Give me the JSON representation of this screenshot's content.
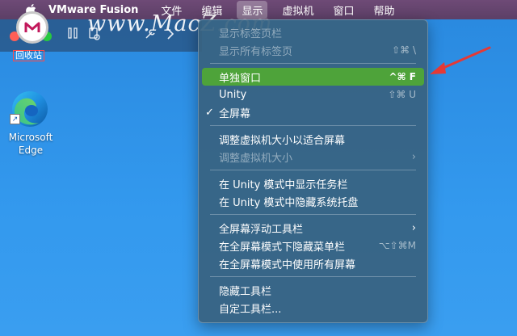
{
  "menubar": {
    "app_name": "VMware Fusion",
    "items": [
      "文件",
      "编辑",
      "显示",
      "虚拟机",
      "窗口",
      "帮助"
    ],
    "active_index": 2
  },
  "watermark": {
    "text": "www.MacZ.com"
  },
  "desktop": {
    "trash_label": "回收站",
    "edge_label_1": "Microsoft",
    "edge_label_2": "Edge"
  },
  "menu": {
    "g1": [
      {
        "label": "显示标签页栏",
        "shortcut": "",
        "disabled": true
      },
      {
        "label": "显示所有标签页",
        "shortcut": "⇧⌘ \\",
        "disabled": true
      }
    ],
    "g2": [
      {
        "label": "单独窗口",
        "shortcut": "^⌘ F",
        "highlight": true
      },
      {
        "label": "Unity",
        "shortcut": "⇧⌘ U"
      },
      {
        "label": "全屏幕",
        "shortcut": "",
        "checked": true,
        "check": "✓"
      }
    ],
    "g3": [
      {
        "label": "调整虚拟机大小以适合屏幕",
        "shortcut": ""
      },
      {
        "label": "调整虚拟机大小",
        "shortcut": "",
        "disabled": true,
        "submenu": true
      }
    ],
    "g4": [
      {
        "label": "在 Unity 模式中显示任务栏",
        "shortcut": ""
      },
      {
        "label": "在 Unity 模式中隐藏系统托盘",
        "shortcut": ""
      }
    ],
    "g5": [
      {
        "label": "全屏幕浮动工具栏",
        "shortcut": "",
        "submenu": true
      },
      {
        "label": "在全屏幕模式下隐藏菜单栏",
        "shortcut": "⌥⇧⌘M"
      },
      {
        "label": "在全屏幕模式中使用所有屏幕",
        "shortcut": ""
      }
    ],
    "g6": [
      {
        "label": "隐藏工具栏",
        "shortcut": ""
      },
      {
        "label": "自定工具栏...",
        "shortcut": ""
      }
    ],
    "chevron": "›"
  },
  "colors": {
    "menubar": "#5c3f66",
    "menu_bg": "#386280",
    "highlight": "#4ea33a",
    "desktop": "#2f8fe6",
    "arrow": "#e53935"
  },
  "icons": [
    "apple-icon",
    "macz-logo-icon",
    "pause-icon",
    "snapshot-icon",
    "tools-icon",
    "forward-icon",
    "edge-icon",
    "shortcut-arrow-icon"
  ]
}
